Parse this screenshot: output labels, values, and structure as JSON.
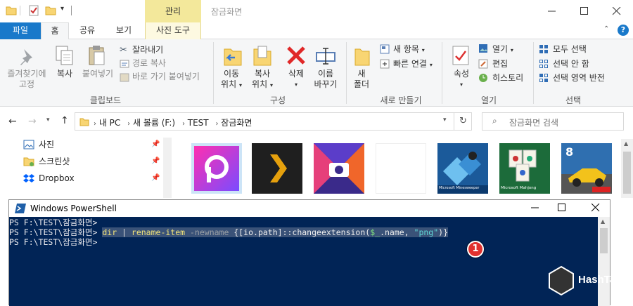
{
  "titlebar": {
    "context_tab": "관리",
    "window_title": "잠금화면"
  },
  "tabs": [
    {
      "label": "파일"
    },
    {
      "label": "홈"
    },
    {
      "label": "공유"
    },
    {
      "label": "보기"
    },
    {
      "label": "사진 도구"
    }
  ],
  "ribbon": {
    "clipboard": {
      "pin": "즐겨찾기에\n고정",
      "pin_line1": "즐겨찾기에",
      "pin_line2": "고정",
      "copy": "복사",
      "paste": "붙여넣기",
      "cut": "잘라내기",
      "copy_path": "경로 복사",
      "paste_shortcut": "바로 가기 붙여넣기",
      "group": "클립보드"
    },
    "organize": {
      "move_to_1": "이동",
      "move_to_2": "위치",
      "copy_to_1": "복사",
      "copy_to_2": "위치",
      "delete": "삭제",
      "rename_1": "이름",
      "rename_2": "바꾸기",
      "group": "구성"
    },
    "new": {
      "new_folder_1": "새",
      "new_folder_2": "폴더",
      "new_item": "새 항목",
      "easy_access": "빠른 연결",
      "group": "새로 만들기"
    },
    "open": {
      "properties": "속성",
      "open": "열기",
      "edit": "편집",
      "history": "히스토리",
      "group": "열기"
    },
    "select": {
      "select_all": "모두 선택",
      "select_none": "선택 안 함",
      "invert": "선택 영역 반전",
      "group": "선택"
    }
  },
  "address": {
    "crumbs": [
      "내 PC",
      "새 볼륨 (F:)",
      "TEST",
      "잠금화면"
    ],
    "search_placeholder": "잠금화면 검색"
  },
  "nav": [
    {
      "label": "사진",
      "icon": "pictures-icon"
    },
    {
      "label": "스크린샷",
      "icon": "folder-icon"
    },
    {
      "label": "Dropbox",
      "icon": "dropbox-icon"
    }
  ],
  "thumbs": [
    {
      "name": "picsart",
      "caption": ""
    },
    {
      "name": "plex",
      "caption": ""
    },
    {
      "name": "camera",
      "caption": ""
    },
    {
      "name": "blank",
      "caption": ""
    },
    {
      "name": "minesweeper",
      "caption": "Microsoft Minesweeper"
    },
    {
      "name": "mahjong",
      "caption": "Microsoft Mahjong"
    },
    {
      "name": "asphalt",
      "caption": "8"
    }
  ],
  "powershell": {
    "title": "Windows PowerShell",
    "prompt1": "PS F:\\TEST\\잠금화면>",
    "prompt2": "PS F:\\TEST\\잠금화면>",
    "prompt3": "PS F:\\TEST\\잠금화면>",
    "cmd_dir": "dir",
    "cmd_pipe": " | ",
    "cmd_rename": "rename-item",
    "cmd_param": " -newname ",
    "cmd_brace": "{[io.path]::changeextension(",
    "cmd_var": "$_",
    "cmd_prop": ".name, ",
    "cmd_str": "\"png\"",
    "cmd_end": ")}",
    "badge": "1"
  },
  "watermark": "HashTag",
  "colors": {
    "file_tab": "#1979ca",
    "context": "#f3e89b",
    "ps_bg": "#012456",
    "badge": "#e0312e"
  }
}
